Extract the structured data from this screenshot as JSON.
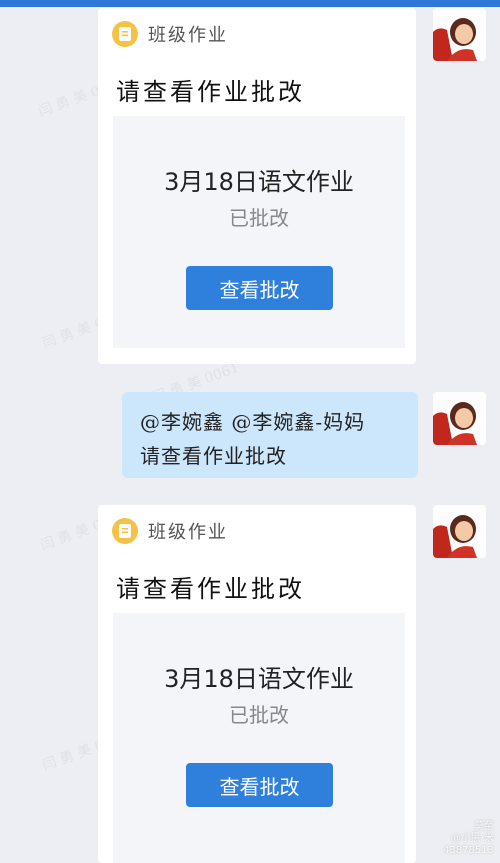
{
  "colors": {
    "accent": "#2f7fdd",
    "background": "#eceef3",
    "bubble": "#cce6fb",
    "app_icon": "#f6c246"
  },
  "watermark_text": "闫 勇 美 0061",
  "messages": [
    {
      "type": "homework-card",
      "app_name": "班级作业",
      "title": "请查看作业批改",
      "assignment_title": "3月18日语文作业",
      "status": "已批改",
      "button_label": "查看批改",
      "avatar_icon": "user-avatar-icon"
    },
    {
      "type": "text",
      "lines": [
        "@李婉鑫 @李婉鑫-妈妈",
        "请查看作业批改"
      ],
      "avatar_icon": "user-avatar-icon"
    },
    {
      "type": "homework-card",
      "app_name": "班级作业",
      "title": "请查看作业批改",
      "assignment_title": "3月18日语文作业",
      "status": "已批改",
      "button_label": "查看批改",
      "avatar_icon": "user-avatar-icon"
    }
  ],
  "bottom_mark": {
    "line1": "莫至",
    "line2": "@小黑·米",
    "line3": "43878513"
  }
}
